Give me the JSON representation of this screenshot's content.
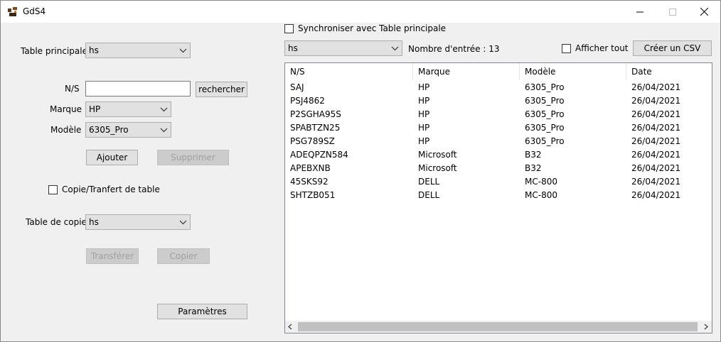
{
  "window": {
    "title": "GdS4"
  },
  "left": {
    "table_principale_label": "Table principale",
    "table_principale_value": "hs",
    "ns_label": "N/S",
    "ns_value": "",
    "rechercher_label": "rechercher",
    "marque_label": "Marque",
    "marque_value": "HP",
    "modele_label": "Modèle",
    "modele_value": "6305_Pro",
    "ajouter_label": "Ajouter",
    "supprimer_label": "Supprimer",
    "copie_label": "Copie/Tranfert de table",
    "table_copie_label": "Table de copie",
    "table_copie_value": "hs",
    "transferer_label": "Transférer",
    "copier_label": "Copier",
    "parametres_label": "Paramètres"
  },
  "right": {
    "sync_label": "Synchroniser avec Table principale",
    "table_value": "hs",
    "count_text": "Nombre d'entrée : 13",
    "afficher_tout_label": "Afficher tout",
    "csv_label": "Créer un CSV",
    "columns": [
      "N/S",
      "Marque",
      "Modèle",
      "Date"
    ],
    "rows": [
      [
        "SAJ",
        "HP",
        "6305_Pro",
        "26/04/2021"
      ],
      [
        "PSJ4862",
        "HP",
        "6305_Pro",
        "26/04/2021"
      ],
      [
        "P2SGHA95S",
        "HP",
        "6305_Pro",
        "26/04/2021"
      ],
      [
        "SPABTZN25",
        "HP",
        "6305_Pro",
        "26/04/2021"
      ],
      [
        "PSG789SZ",
        "HP",
        "6305_Pro",
        "26/04/2021"
      ],
      [
        "ADEQPZN584",
        "Microsoft",
        "B32",
        "26/04/2021"
      ],
      [
        "APEBXNB",
        "Microsoft",
        "B32",
        "26/04/2021"
      ],
      [
        "45SKS92",
        "DELL",
        "MC-800",
        "26/04/2021"
      ],
      [
        "SHTZB051",
        "DELL",
        "MC-800",
        "26/04/2021"
      ]
    ]
  }
}
